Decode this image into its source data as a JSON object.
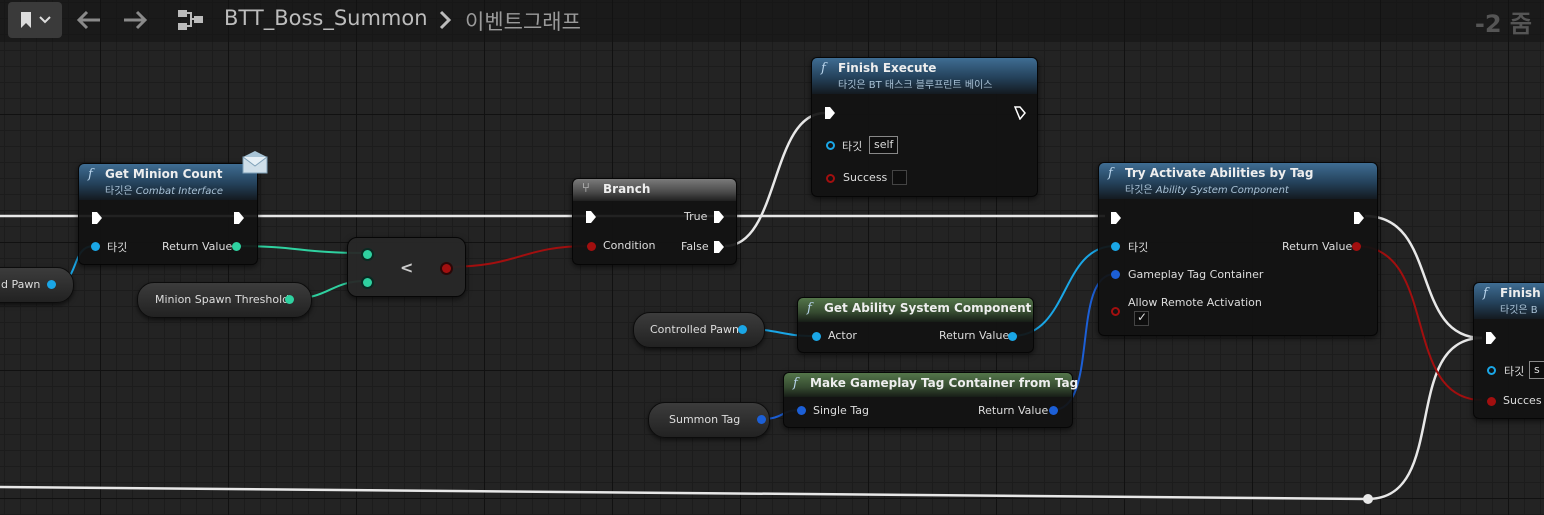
{
  "toolbar": {
    "back_icon": "arrow-left-icon",
    "forward_icon": "arrow-right-icon",
    "breadcrumb_title": "BTT_Boss_Summon",
    "breadcrumb_sub": "이벤트그래프",
    "zoom": "-2 줌"
  },
  "nodes": {
    "get_minion_count": {
      "title": "Get Minion Count",
      "sub_prefix": "타깃은 ",
      "sub_target": "Combat Interface",
      "target_label": "타깃",
      "return_label": "Return Value"
    },
    "branch": {
      "title": "Branch",
      "true_label": "True",
      "false_label": "False",
      "condition_label": "Condition"
    },
    "compare": {
      "op": "<"
    },
    "finish_execute": {
      "title": "Finish Execute",
      "sub": "타깃은 BT 태스크 블루프린트 베이스",
      "target_label": "타깃",
      "target_value": "self",
      "success_label": "Success"
    },
    "try_activate": {
      "title": "Try Activate Abilities by Tag",
      "sub_prefix": "타깃은 ",
      "sub_target": "Ability System Component",
      "target_label": "타깃",
      "return_label": "Return Value",
      "tag_container_label": "Gameplay Tag Container",
      "allow_remote_label": "Allow Remote Activation",
      "allow_remote_checked": true
    },
    "get_asc": {
      "title": "Get Ability System Component",
      "actor_label": "Actor",
      "return_label": "Return Value"
    },
    "make_tag_container": {
      "title": "Make Gameplay Tag Container from Tag",
      "single_tag_label": "Single Tag",
      "return_label": "Return Value"
    },
    "finish_right": {
      "title": "Finish E",
      "sub": "타깃은 B",
      "target_label": "타깃",
      "target_value": "s",
      "success_label": "Succes"
    }
  },
  "variables": {
    "controlled_pawn_left": "d Pawn",
    "minion_spawn_threshold": "Minion Spawn Threshold",
    "controlled_pawn": "Controlled Pawn",
    "summon_tag": "Summon Tag"
  },
  "colors": {
    "exec": "#ffffff",
    "object_pin": "#1aa6e6",
    "int_pin": "#2fd1a0",
    "struct_pin": "#1c5fd6",
    "bool_pin": "#a20f0f"
  }
}
